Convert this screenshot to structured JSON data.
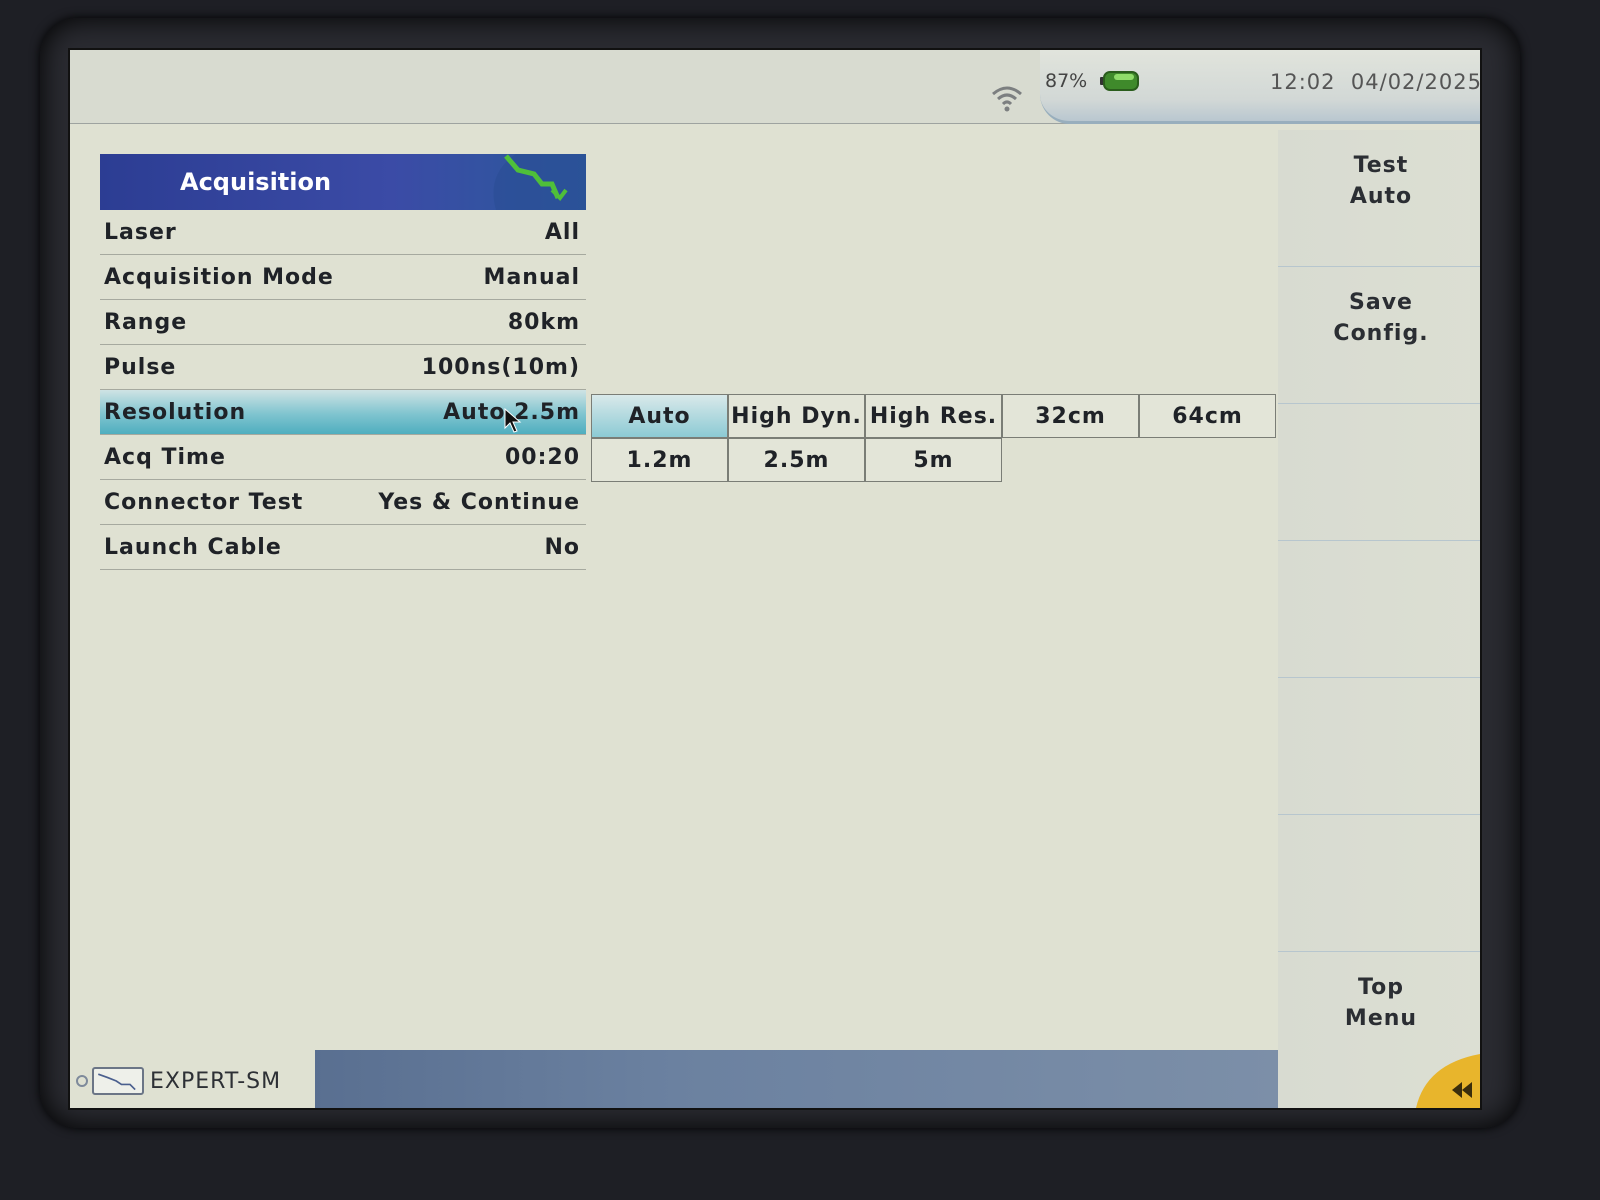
{
  "status": {
    "battery_percent": "87%",
    "time": "12:02",
    "date": "04/02/2025"
  },
  "panel": {
    "title": "Acquisition",
    "rows": [
      {
        "label": "Laser",
        "value": "All"
      },
      {
        "label": "Acquisition Mode",
        "value": "Manual"
      },
      {
        "label": "Range",
        "value": "80km"
      },
      {
        "label": "Pulse",
        "value": "100ns(10m)"
      },
      {
        "label": "Resolution",
        "value": "Auto 2.5m",
        "selected": true
      },
      {
        "label": "Acq Time",
        "value": "00:20"
      },
      {
        "label": "Connector Test",
        "value": "Yes & Continue"
      },
      {
        "label": "Launch Cable",
        "value": "No"
      }
    ]
  },
  "resolution_options": {
    "row1": [
      "Auto",
      "High Dyn.",
      "High Res.",
      "32cm",
      "64cm"
    ],
    "row2": [
      "1.2m",
      "2.5m",
      "5m"
    ],
    "active": "Auto"
  },
  "softkeys": {
    "test_auto": [
      "Test",
      "Auto"
    ],
    "save_config": [
      "Save",
      "Config."
    ],
    "top_menu": [
      "Top",
      "Menu"
    ]
  },
  "bottom": {
    "module_label": "EXPERT-SM"
  },
  "colors": {
    "header_blue": "#2c3d93",
    "selected_teal": "#4faebf",
    "screen_bg": "#dfe1d2",
    "trace_green": "#4fbf3a",
    "back_orange": "#e8b52c"
  },
  "icons": [
    "wifi-icon",
    "battery-icon",
    "trace-icon",
    "cursor-icon",
    "back-arrow-icon"
  ]
}
